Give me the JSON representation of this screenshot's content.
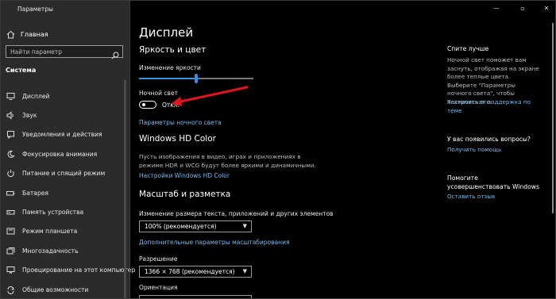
{
  "window": {
    "title": "Параметры",
    "controls": {
      "minimize": "—",
      "maximize": "▫",
      "close": "✕"
    }
  },
  "sidebar": {
    "home_label": "Главная",
    "search_placeholder": "Найти параметр",
    "section_title": "Система",
    "items": [
      {
        "label": "Дисплей",
        "icon": "monitor-icon"
      },
      {
        "label": "Звук",
        "icon": "speaker-icon"
      },
      {
        "label": "Уведомления и действия",
        "icon": "notification-icon"
      },
      {
        "label": "Фокусировка внимания",
        "icon": "moon-icon"
      },
      {
        "label": "Питание и спящий режим",
        "icon": "power-icon"
      },
      {
        "label": "Батарея",
        "icon": "battery-icon"
      },
      {
        "label": "Память устройства",
        "icon": "storage-icon"
      },
      {
        "label": "Режим планшета",
        "icon": "tablet-icon"
      },
      {
        "label": "Многозадачность",
        "icon": "multitasking-icon"
      },
      {
        "label": "Проецирование на этот компьютер",
        "icon": "projector-icon"
      },
      {
        "label": "Общие возможности",
        "icon": "shared-icon"
      }
    ]
  },
  "main": {
    "page_title": "Дисплей",
    "brightness_section": "Яркость и цвет",
    "brightness_label": "Изменение яркости",
    "brightness_value": 0.5,
    "night_light_label": "Ночной свет",
    "night_light_state": "Откл.",
    "night_light_settings_link": "Параметры ночного света",
    "hdr_section": "Windows HD Color",
    "hdr_description": "Пусть изображения в видео, играх и приложениях в режиме HDR и WCG будут более яркими и динамичными.",
    "hdr_settings_link": "Настройки Windows HD Color",
    "scale_section": "Масштаб и разметка",
    "scale_label": "Изменение размера текста, приложений и других элементов",
    "scale_value": "100% (рекомендуется)",
    "advanced_scale_link": "Дополнительные параметры масштабирования",
    "resolution_label": "Разрешение",
    "resolution_value": "1366 × 768 (рекомендуется)",
    "orientation_label": "Ориентация"
  },
  "aside": {
    "night_title": "Спите лучше",
    "night_text": "Ночной свет поможет вам заснуть, отображая на экране более теплые цвета. Выберите \"Параметры ночного света\", чтобы настроить его.",
    "night_link": "Техническая поддержка по теме",
    "question_title": "У вас появились вопросы?",
    "question_link": "Получить помощь",
    "improve_title": "Помогите усовершенствовать Windows",
    "improve_link": "Оставить отзыв"
  },
  "colors": {
    "accent": "#3a8fde",
    "link": "#76b9ed",
    "sidebar_bg": "#2b2b2b",
    "annotation_arrow": "#e0141c"
  }
}
